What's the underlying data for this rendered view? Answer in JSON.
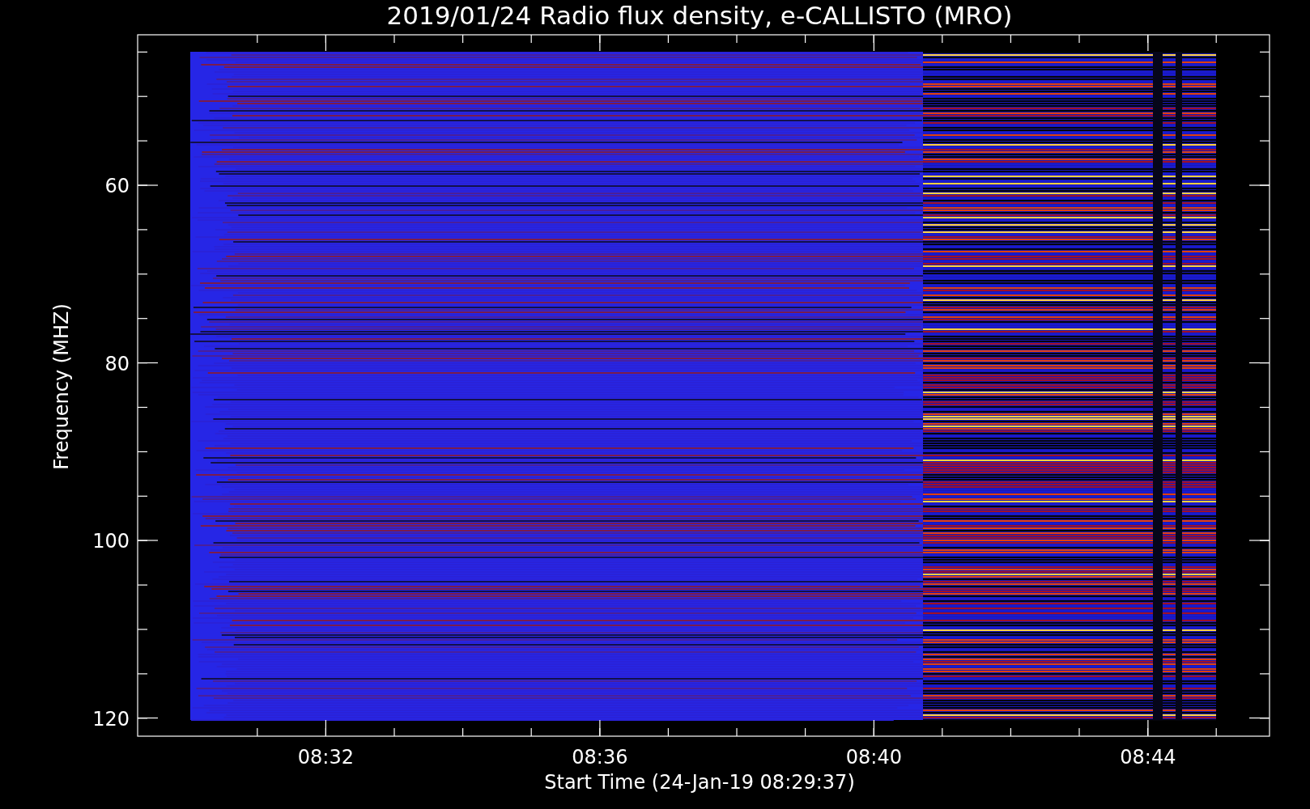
{
  "title": "2019/01/24  Radio flux density, e-CALLISTO (MRO)",
  "y_axis": {
    "label": "Frequency (MHZ)",
    "ticks": [
      "60",
      "80",
      "100",
      "120"
    ]
  },
  "x_axis": {
    "label": "Start Time (24-Jan-19 08:29:37)",
    "ticks": [
      "08:32",
      "08:36",
      "08:40",
      "08:44"
    ]
  }
}
